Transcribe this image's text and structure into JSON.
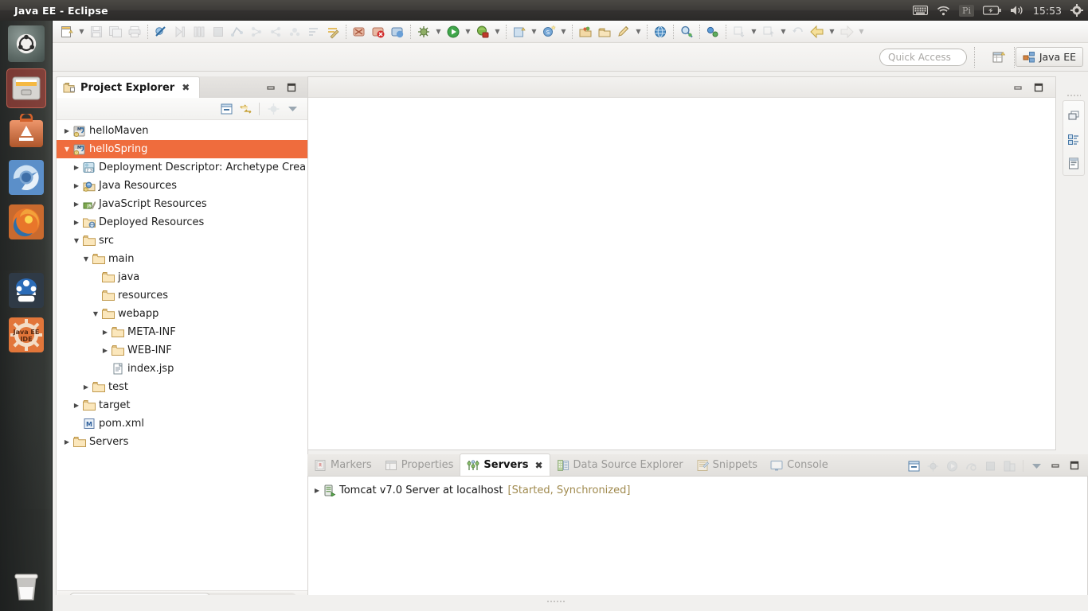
{
  "window": {
    "title": "Java EE - Eclipse"
  },
  "topbar": {
    "clock": "15:53",
    "indicators": [
      "keyboard-icon",
      "wifi-icon",
      "pi-icon",
      "battery-icon",
      "volume-icon",
      "gear-icon"
    ]
  },
  "launcher": {
    "items": [
      {
        "name": "ubuntu-dash-icon",
        "label": "Dash home"
      },
      {
        "name": "files-icon",
        "label": "Files"
      },
      {
        "name": "software-center-icon",
        "label": "Ubuntu Software Center"
      },
      {
        "name": "chromium-icon",
        "label": "Chromium"
      },
      {
        "name": "firefox-icon",
        "label": "Firefox"
      },
      {
        "name": "system-settings-icon",
        "label": "System Settings"
      },
      {
        "name": "eclipse-javaee-icon",
        "label": "Java EE IDE"
      },
      {
        "name": "trash-icon",
        "label": "Trash"
      }
    ]
  },
  "toolbar": {
    "groups": [
      [
        "new-wizard",
        "new-wizard-dropdown",
        "save",
        "save-all",
        "print"
      ],
      [
        "toggle-breakpoint",
        "debug-step",
        "columns",
        "stop"
      ],
      [
        "link-editor",
        "collapse-all",
        "expand-all",
        "filter",
        "sort",
        "prefs"
      ],
      [
        "validate-error",
        "validate-warning",
        "validate-ok"
      ],
      [
        "debug",
        "debug-dropdown",
        "run",
        "run-dropdown",
        "run-server",
        "run-server-dropdown"
      ],
      [
        "new-java-project",
        "new-java-project-dropdown",
        "new-spring-bean",
        "new-spring-bean-dropdown"
      ],
      [
        "new-package",
        "new-class",
        "new-annotation",
        "new-annotation-dropdown"
      ],
      [
        "open-web-browser"
      ],
      [
        "search"
      ],
      [
        "deploy"
      ],
      [
        "next-annotation",
        "next-annotation-dropdown",
        "previous-annotation",
        "previous-annotation-dropdown"
      ],
      [
        "back-history",
        "forward-history",
        "forward-dropdown",
        "last-edit"
      ]
    ]
  },
  "quick_access": {
    "placeholder": "Quick Access",
    "value": ""
  },
  "perspective": {
    "open_perspective_tooltip": "Open Perspective",
    "active": "Java EE"
  },
  "project_explorer": {
    "title": "Project Explorer",
    "close_glyph": "✖",
    "minimize_glyph": "–",
    "maximize_glyph": "□",
    "toolbar_buttons": [
      "collapse-all-icon",
      "link-with-editor-icon",
      "focus-on-active-task-icon",
      "view-menu-icon"
    ],
    "tree": [
      {
        "label": "helloMaven",
        "depth": 0,
        "twisty": "collapsed",
        "icon": "maven-project-icon",
        "selected": false
      },
      {
        "label": "helloSpring",
        "depth": 0,
        "twisty": "expanded",
        "icon": "maven-project-icon",
        "selected": true
      },
      {
        "label": "Deployment Descriptor: Archetype Crea",
        "depth": 1,
        "twisty": "collapsed",
        "icon": "deployment-descriptor-icon",
        "selected": false
      },
      {
        "label": "Java Resources",
        "depth": 1,
        "twisty": "collapsed",
        "icon": "java-resources-icon",
        "selected": false
      },
      {
        "label": "JavaScript Resources",
        "depth": 1,
        "twisty": "collapsed",
        "icon": "javascript-resources-icon",
        "selected": false
      },
      {
        "label": "Deployed Resources",
        "depth": 1,
        "twisty": "collapsed",
        "icon": "deployed-resources-icon",
        "selected": false
      },
      {
        "label": "src",
        "depth": 1,
        "twisty": "expanded",
        "icon": "folder-icon",
        "selected": false
      },
      {
        "label": "main",
        "depth": 2,
        "twisty": "expanded",
        "icon": "folder-icon",
        "selected": false
      },
      {
        "label": "java",
        "depth": 3,
        "twisty": "none",
        "icon": "folder-icon",
        "selected": false
      },
      {
        "label": "resources",
        "depth": 3,
        "twisty": "none",
        "icon": "folder-icon",
        "selected": false
      },
      {
        "label": "webapp",
        "depth": 3,
        "twisty": "expanded",
        "icon": "folder-icon",
        "selected": false
      },
      {
        "label": "META-INF",
        "depth": 4,
        "twisty": "collapsed",
        "icon": "folder-icon",
        "selected": false
      },
      {
        "label": "WEB-INF",
        "depth": 4,
        "twisty": "collapsed",
        "icon": "folder-icon",
        "selected": false
      },
      {
        "label": "index.jsp",
        "depth": 4,
        "twisty": "none",
        "icon": "jsp-file-icon",
        "selected": false
      },
      {
        "label": "test",
        "depth": 2,
        "twisty": "collapsed",
        "icon": "folder-icon",
        "selected": false
      },
      {
        "label": "target",
        "depth": 1,
        "twisty": "collapsed",
        "icon": "folder-icon",
        "selected": false
      },
      {
        "label": "pom.xml",
        "depth": 1,
        "twisty": "none",
        "icon": "pom-file-icon",
        "selected": false
      },
      {
        "label": "Servers",
        "depth": 0,
        "twisty": "collapsed",
        "icon": "folder-icon",
        "selected": false
      }
    ],
    "selection_color": "#ef6c3d"
  },
  "editor_area": {
    "minimize_glyph": "–",
    "maximize_glyph": "□",
    "content": ""
  },
  "rail": {
    "buttons": [
      "restore-editor-icon",
      "outline-view-icon",
      "task-list-icon"
    ]
  },
  "bottom_panel": {
    "tabs": [
      {
        "label": "Markers",
        "icon": "markers-icon",
        "active": false
      },
      {
        "label": "Properties",
        "icon": "properties-icon",
        "active": false
      },
      {
        "label": "Servers",
        "icon": "servers-icon",
        "active": true
      },
      {
        "label": "Data Source Explorer",
        "icon": "data-source-explorer-icon",
        "active": false
      },
      {
        "label": "Snippets",
        "icon": "snippets-icon",
        "active": false
      },
      {
        "label": "Console",
        "icon": "console-icon",
        "active": false
      }
    ],
    "close_glyph": "✖",
    "tools": [
      "collapse-all-icon",
      "debug-server-icon",
      "start-server-icon",
      "profile-server-icon",
      "stop-server-icon",
      "publish-server-icon"
    ],
    "menu_glyph": "▼",
    "minimize_glyph": "–",
    "maximize_glyph": "□",
    "servers": [
      {
        "twisty": "collapsed",
        "icon": "tomcat-server-icon",
        "name": "Tomcat v7.0 Server at localhost",
        "status": "[Started, Synchronized]",
        "status_color": "#a08a4e"
      }
    ]
  }
}
